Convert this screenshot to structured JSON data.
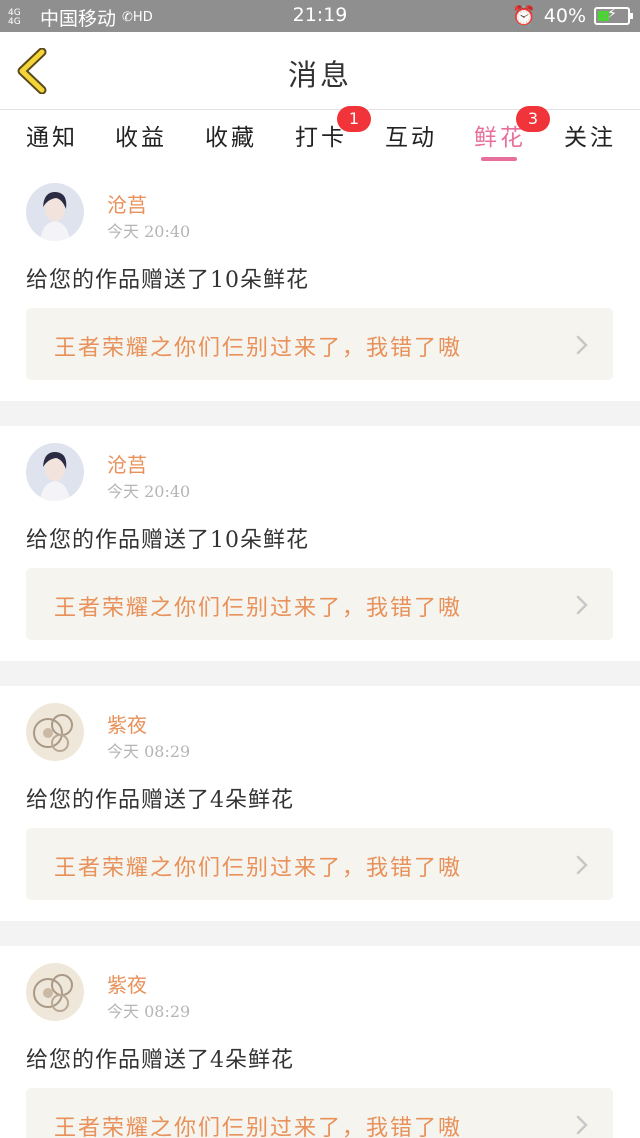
{
  "status_bar": {
    "network": "4G 4G",
    "carrier": "中国移动",
    "hd_label": "HD",
    "time": "21:19",
    "battery": "40%",
    "battery_level": 0.4
  },
  "header": {
    "title": "消息",
    "back_icon": "chevron-left-icon"
  },
  "tabs": [
    {
      "label": "通知",
      "badge": ""
    },
    {
      "label": "收益",
      "badge": ""
    },
    {
      "label": "收藏",
      "badge": ""
    },
    {
      "label": "打卡",
      "badge": "1"
    },
    {
      "label": "互动",
      "badge": ""
    },
    {
      "label": "鲜花",
      "badge": "3",
      "active": true
    },
    {
      "label": "关注",
      "badge": ""
    }
  ],
  "colors": {
    "accent": "#e86f9c",
    "name": "#e8915a",
    "badge": "#f0343a"
  },
  "feed": [
    {
      "name": "沧莒",
      "time": "今天 20:40",
      "message": "给您的作品赠送了10朵鲜花",
      "work_title": "王者荣耀之你们仨别过来了，我错了嗷",
      "avatar": "anime-boy-avatar"
    },
    {
      "name": "沧莒",
      "time": "今天 20:40",
      "message": "给您的作品赠送了10朵鲜花",
      "work_title": "王者荣耀之你们仨别过来了，我错了嗷",
      "avatar": "anime-boy-avatar"
    },
    {
      "name": "紫夜",
      "time": "今天 08:29",
      "message": "给您的作品赠送了4朵鲜花",
      "work_title": "王者荣耀之你们仨别过来了，我错了嗷",
      "avatar": "paisley-avatar"
    },
    {
      "name": "紫夜",
      "time": "今天 08:29",
      "message": "给您的作品赠送了4朵鲜花",
      "work_title": "王者荣耀之你们仨别过来了，我错了嗷",
      "avatar": "paisley-avatar"
    }
  ]
}
